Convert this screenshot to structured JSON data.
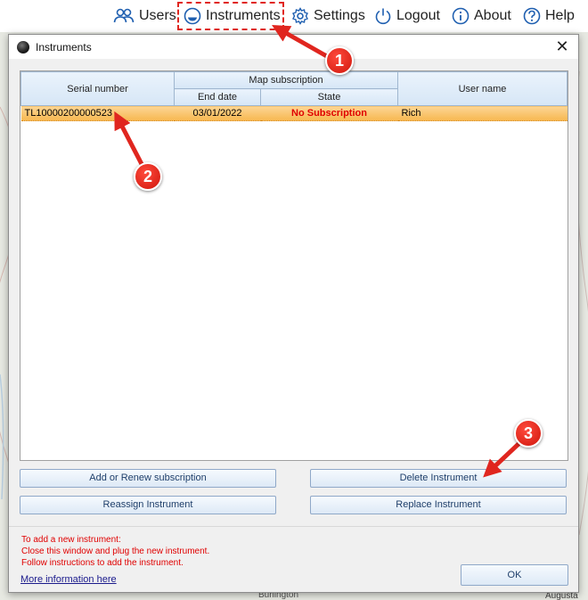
{
  "nav": {
    "users": "Users",
    "instruments": "Instruments",
    "settings": "Settings",
    "logout": "Logout",
    "about": "About",
    "help": "Help"
  },
  "dialog": {
    "title": "Instruments",
    "close_glyph": "✕"
  },
  "grid": {
    "headers": {
      "serial": "Serial number",
      "map_subscription": "Map subscription",
      "end_date": "End date",
      "state": "State",
      "user_name": "User name"
    },
    "rows": [
      {
        "serial": "TL10000200000523",
        "end_date": "03/01/2022",
        "state": "No Subscription",
        "user_name": "Rich"
      }
    ]
  },
  "buttons": {
    "add_renew": "Add or Renew subscription",
    "delete": "Delete Instrument",
    "reassign": "Reassign Instrument",
    "replace": "Replace Instrument",
    "ok": "OK"
  },
  "info": {
    "line1": "To add a new instrument:",
    "line2": "Close this window and plug the new instrument.",
    "line3": "Follow instructions to add the instrument.",
    "link": "More  information here"
  },
  "annotations": {
    "step1": "1",
    "step2": "2",
    "step3": "3"
  },
  "map_labels": {
    "bottom_center": "Burlington",
    "bottom_right": "Augusta"
  },
  "colors": {
    "accent_blue": "#1f5fb0",
    "selected_row": "#f7b74f",
    "warning_red": "#e00000",
    "annotation_red": "#e0261f"
  },
  "icons": {
    "users": "users-icon",
    "instruments": "instrument-icon",
    "settings": "gear-icon",
    "logout": "power-icon",
    "about": "info-icon",
    "help": "help-icon"
  }
}
